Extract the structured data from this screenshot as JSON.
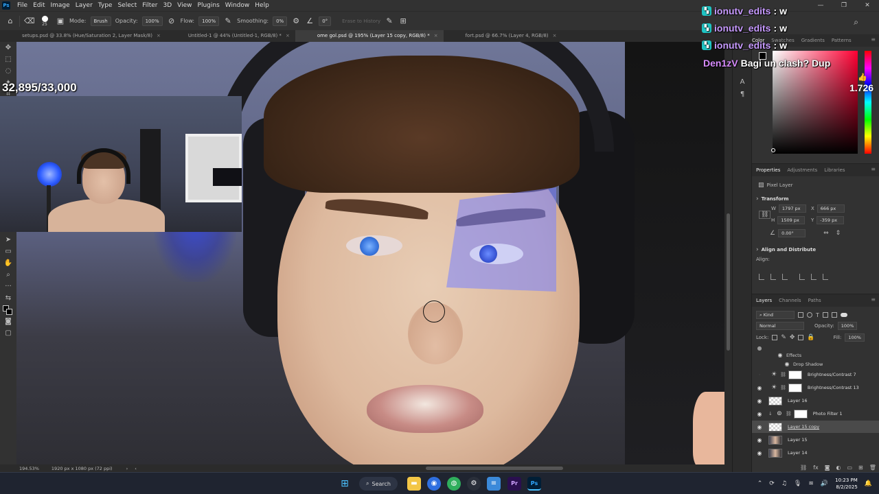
{
  "app": {
    "menu": [
      "File",
      "Edit",
      "Image",
      "Layer",
      "Type",
      "Select",
      "Filter",
      "3D",
      "View",
      "Plugins",
      "Window",
      "Help"
    ]
  },
  "options": {
    "brush_size": "25",
    "mode_label": "Mode:",
    "mode_value": "Brush",
    "opacity_label": "Opacity:",
    "opacity_value": "100%",
    "flow_label": "Flow:",
    "flow_value": "100%",
    "smoothing_label": "Smoothing:",
    "smoothing_value": "0%",
    "angle_value": "0°",
    "erase_history": "Erase to History"
  },
  "tabs": [
    {
      "label": "setups.psd @ 33.8% (Hue/Saturation 2, Layer Mask/8)"
    },
    {
      "label": "Untitled-1 @ 44% (Untitled-1, RGB/8) *"
    },
    {
      "label": "ome gol.psd @ 195% (Layer 15 copy, RGB/8) *"
    },
    {
      "label": "fort.psd @ 66.7% (Layer 4, RGB/8)"
    }
  ],
  "overlay": {
    "counter": "32,895/33,000",
    "big_number": "1.726"
  },
  "chat": [
    {
      "user": "ionutv_edits",
      "msg": "w"
    },
    {
      "user": "ionutv_edits",
      "msg": "w"
    },
    {
      "user": "ionutv_edits",
      "msg": "w"
    },
    {
      "user": "Den1zV",
      "msg": "Bagi un clash? Dup"
    }
  ],
  "color_panel": {
    "tabs": [
      "Color",
      "Swatches",
      "Gradients",
      "Patterns"
    ]
  },
  "properties": {
    "tabs": [
      "Properties",
      "Adjustments",
      "Libraries"
    ],
    "kind": "Pixel Layer",
    "transform_title": "Transform",
    "w_label": "W",
    "w_value": "1797 px",
    "h_label": "H",
    "h_value": "1509 px",
    "x_label": "X",
    "x_value": "666 px",
    "y_label": "Y",
    "y_value": "-359 px",
    "angle_value": "0.00°",
    "align_title": "Align and Distribute",
    "align_label": "Align:"
  },
  "layers": {
    "tabs": [
      "Layers",
      "Channels",
      "Paths"
    ],
    "filter_kind": "Kind",
    "blend_mode": "Normal",
    "opacity_label": "Opacity:",
    "opacity_value": "100%",
    "lock_label": "Lock:",
    "fill_label": "Fill:",
    "fill_value": "100%",
    "effects_label": "Effects",
    "drop_shadow_label": "Drop Shadow",
    "rows": [
      {
        "name": "Brightness/Contrast 7"
      },
      {
        "name": "Brightness/Contrast 13"
      },
      {
        "name": "Layer 16"
      },
      {
        "name": "Photo Filter 1"
      },
      {
        "name": "Layer 15 copy"
      },
      {
        "name": "Layer 15"
      },
      {
        "name": "Layer 14"
      }
    ]
  },
  "status": {
    "zoom": "194.53%",
    "doc_size": "1920 px x 1080 px (72 ppi)"
  },
  "taskbar": {
    "search_label": "Search",
    "time": "10:23 PM",
    "date": "8/2/2025"
  }
}
